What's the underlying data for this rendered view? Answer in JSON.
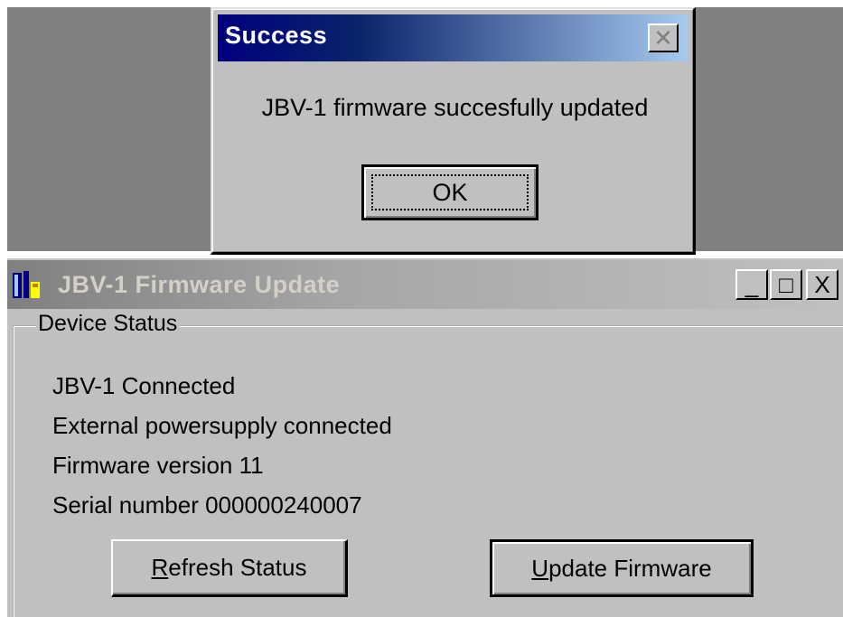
{
  "success_dialog": {
    "title": "Success",
    "close_glyph": "✕",
    "message": "JBV-1 firmware succesfully updated",
    "ok_label": "OK"
  },
  "main_window": {
    "title": "JBV-1 Firmware Update",
    "icon": "app-icon",
    "controls": {
      "minimize_glyph": "_",
      "maximize_glyph": "□",
      "close_glyph": "X"
    },
    "group_label": "Device Status",
    "status_lines": [
      "JBV-1 Connected",
      "External powersupply connected",
      "Firmware version 11",
      "Serial number 000000240007"
    ],
    "buttons": {
      "refresh": {
        "accel": "R",
        "rest": "efresh Status"
      },
      "update": {
        "accel": "U",
        "rest": "pdate Firmware"
      }
    }
  },
  "colors": {
    "active_title_start": "#00007e",
    "active_title_end": "#a6caf0",
    "inactive_title_start": "#808080",
    "inactive_title_end": "#c0c0c0",
    "face": "#c0c0c0",
    "desktop": "#808080"
  }
}
